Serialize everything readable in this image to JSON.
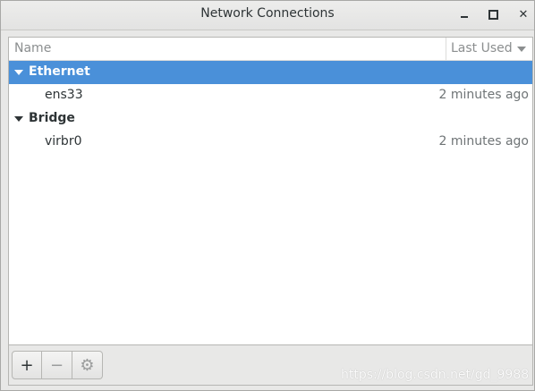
{
  "window": {
    "title": "Network Connections"
  },
  "columns": {
    "name": "Name",
    "last_used": "Last Used"
  },
  "groups": [
    {
      "label": "Ethernet",
      "selected": true,
      "items": [
        {
          "name": "ens33",
          "last_used": "2 minutes ago"
        }
      ]
    },
    {
      "label": "Bridge",
      "selected": false,
      "items": [
        {
          "name": "virbr0",
          "last_used": "2 minutes ago"
        }
      ]
    }
  ],
  "toolbar": {
    "add_label": "+",
    "remove_label": "−",
    "settings_label": "⚙"
  },
  "watermark": "https://blog.csdn.net/gd_9988",
  "icons": {
    "minimize": "minimize-icon",
    "maximize": "maximize-icon",
    "close": "close-icon",
    "expander": "expander-down-icon",
    "sort": "sort-descending-icon",
    "settings": "gear-icon"
  },
  "colors": {
    "selection": "#4a90d9",
    "window_bg": "#e8e8e7"
  }
}
